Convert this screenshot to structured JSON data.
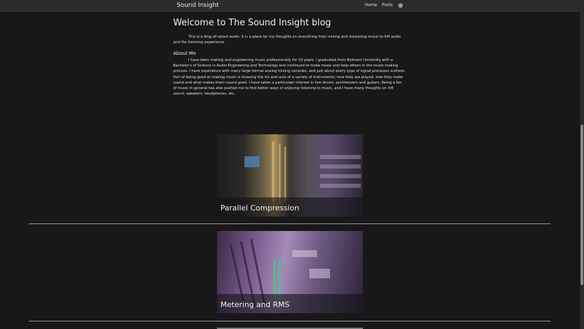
{
  "header": {
    "brand": "Sound Insight",
    "nav": [
      {
        "label": "Home"
      },
      {
        "label": "Posts"
      }
    ],
    "theme_toggle_icon": "sun-icon"
  },
  "main": {
    "title": "Welcome to The Sound Insight blog",
    "intro": "This is a blog all about audio. It is a place for my thoughts on everything from mixing and mastering music to hifi audio and the listening experience.",
    "about_heading": "About Me",
    "about_text": "I have been making and engineering music professionally for 10 years. I graduated from Belmont University with a Bachelor's of Science in Audio Engineering and Technology and continued to make music and help others in the music making process. I have experience with many large format analog mixing consoles, and just about every type of signal processor outhere. Part of being good at making music is knowing the ins and outs of a variety of instruments; how they are played, how they make sound and what makes them sound good. I have taken a particulaer interest in live drums, synthesizers and guitars. Being a fan of music in general has also pushed me to find better ways of enjoying listening to music, and I have many thoughts on hifi sound, speakers, headphones, etc."
  },
  "posts": [
    {
      "title": "Parallel Compression"
    },
    {
      "title": "Metering and RMS"
    }
  ],
  "colors": {
    "background": "#181818",
    "topbar": "#2b2b2b",
    "text": "#e6e6e6",
    "divider": "#9a9a9a"
  }
}
